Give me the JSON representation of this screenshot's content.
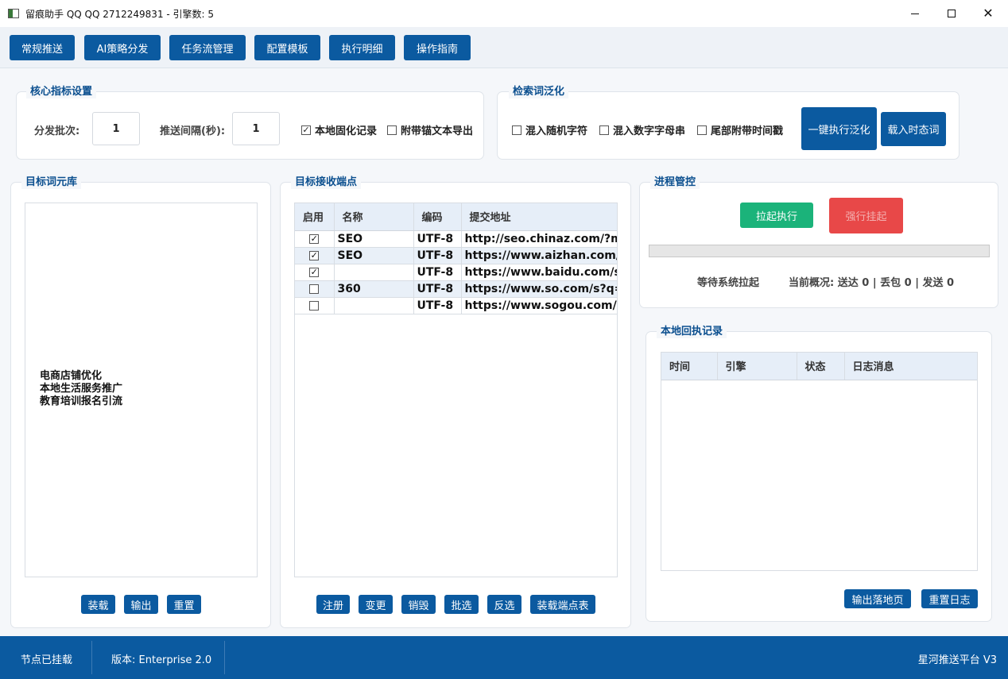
{
  "window": {
    "title": "留痕助手 QQ  QQ 2712249831 - 引擎数: 5"
  },
  "nav": {
    "tabs": [
      "常规推送",
      "AI策略分发",
      "任务流管理",
      "配置模板",
      "执行明细",
      "操作指南"
    ]
  },
  "core": {
    "title": "核心指标设置",
    "batch_label": "分发批次:",
    "batch_value": "1",
    "interval_label": "推送间隔(秒):",
    "interval_value": "1",
    "local_record_label": "本地固化记录",
    "local_record_checked": true,
    "anchor_export_label": "附带锚文本导出",
    "anchor_export_checked": false
  },
  "keyword": {
    "title": "检索词泛化",
    "opt_random": "混入随机字符",
    "opt_alnum": "混入数字字母串",
    "opt_timestamp": "尾部附带时间戳",
    "exec_button": "一键执行泛化",
    "load_button": "载入时态词"
  },
  "wordbank": {
    "title": "目标词元库",
    "items": [
      "电商店铺优化",
      "本地生活服务推广",
      "教育培训报名引流"
    ],
    "buttons": {
      "load": "装载",
      "export": "输出",
      "reset": "重置"
    }
  },
  "endpoints": {
    "title": "目标接收端点",
    "columns": [
      "启用",
      "名称",
      "编码",
      "提交地址"
    ],
    "rows": [
      {
        "enabled": true,
        "name": "SEO",
        "encoding": "UTF-8",
        "url": "http://seo.chinaz.com/?m="
      },
      {
        "enabled": true,
        "name": "SEO",
        "encoding": "UTF-8",
        "url": "https://www.aizhan.com/s"
      },
      {
        "enabled": true,
        "name": "",
        "encoding": "UTF-8",
        "url": "https://www.baidu.com/s?"
      },
      {
        "enabled": false,
        "name": "360",
        "encoding": "UTF-8",
        "url": "https://www.so.com/s?q="
      },
      {
        "enabled": false,
        "name": "",
        "encoding": "UTF-8",
        "url": "https://www.sogou.com/w"
      }
    ],
    "buttons": {
      "register": "注册",
      "change": "变更",
      "destroy": "销毁",
      "batch": "批选",
      "invert": "反选",
      "load_table": "装载端点表"
    }
  },
  "process": {
    "title": "进程管控",
    "start_button": "拉起执行",
    "stop_button": "强行挂起",
    "progress": 0,
    "status_text": "等待系统拉起",
    "summary_text": "当前概况: 送达 0 | 丢包 0 | 发送 0"
  },
  "log": {
    "title": "本地回执记录",
    "columns": [
      "时间",
      "引擎",
      "状态",
      "日志消息"
    ],
    "buttons": {
      "export_page": "输出落地页",
      "reset_log": "重置日志"
    }
  },
  "statusbar": {
    "node": "节点已挂载",
    "version": "版本: Enterprise 2.0",
    "platform": "星河推送平台 V3"
  },
  "colors": {
    "primary": "#0b5aa0",
    "start": "#1bb37a",
    "stop": "#e84848",
    "accent_title": "#0b4f8f"
  }
}
